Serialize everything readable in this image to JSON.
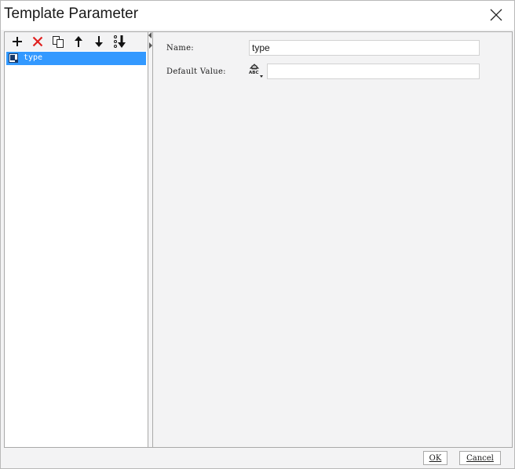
{
  "window": {
    "title": "Template Parameter"
  },
  "toolbar": {
    "buttons": [
      {
        "name": "add-icon"
      },
      {
        "name": "delete-icon"
      },
      {
        "name": "copy-icon"
      },
      {
        "name": "move-up-icon"
      },
      {
        "name": "move-down-icon"
      },
      {
        "name": "sort-icon"
      }
    ]
  },
  "tree": {
    "items": [
      {
        "label": "type",
        "selected": true
      }
    ]
  },
  "form": {
    "name_label": "Name:",
    "name_value": "type",
    "default_value_label": "Default Value:",
    "default_value": "",
    "type_icon_text": "ABC"
  },
  "footer": {
    "ok_label": "OK",
    "cancel_label": "Cancel"
  },
  "colors": {
    "selection": "#3399ff",
    "delete_red": "#e02020",
    "background": "#f3f3f4"
  }
}
